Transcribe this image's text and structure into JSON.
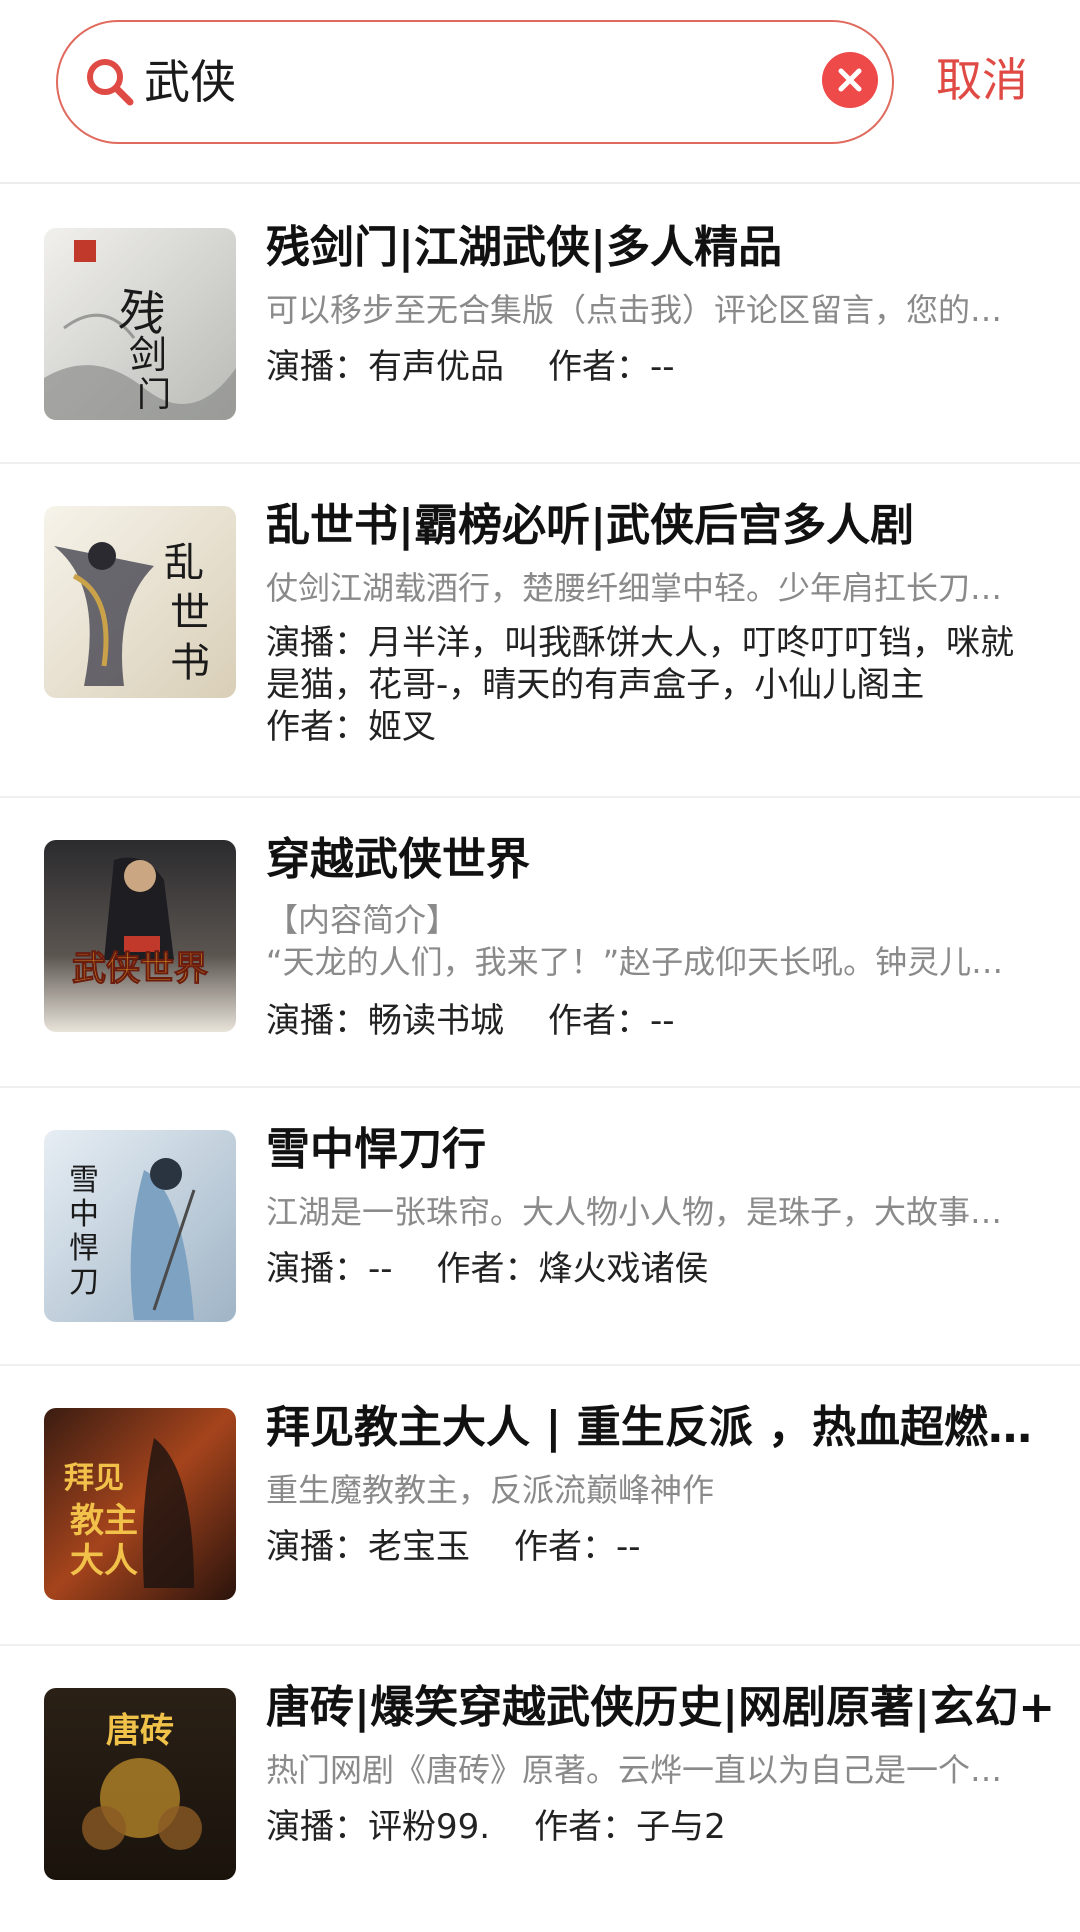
{
  "search": {
    "query": "武侠",
    "cancel_label": "取消"
  },
  "results": [
    {
      "title": "残剑门|江湖武侠|多人精品",
      "desc_lines": [
        "可以移步至无合集版（点击我）评论区留言，您的小小支持，我们的大大动力！"
      ],
      "narrator_label": "演播：",
      "narrator": "有声优品",
      "author_label": "作者：",
      "author": "--",
      "cover_text": "残剑门"
    },
    {
      "title": "乱世书|霸榜必听|武侠后宫多人剧",
      "desc_lines": [
        "仗剑江湖载酒行，楚腰纤细掌中轻。少年肩扛长刀，路过人间。"
      ],
      "narrator_label": "演播：",
      "narrator": "月半洋，叫我酥饼大人，叮咚叮叮铛，咪就是猫，花哥-，晴天的有声盒子，小仙儿阁主",
      "author_label": "作者：",
      "author": "姬叉",
      "cover_text": "乱世书"
    },
    {
      "title": "穿越武侠世界",
      "desc_lines": [
        "【内容简介】",
        "“天龙的人们，我来了！”赵子成仰天长吼。钟灵儿、王语嫣……"
      ],
      "narrator_label": "演播：",
      "narrator": "畅读书城",
      "author_label": "作者：",
      "author": "--",
      "cover_text": "武侠世界"
    },
    {
      "title": "雪中悍刀行",
      "desc_lines": [
        "江湖是一张珠帘。大人物小人物，是珠子，大故事小故事，是串线。"
      ],
      "narrator_label": "演播：",
      "narrator": "--",
      "author_label": "作者：",
      "author": "烽火戏诸侯",
      "cover_text": "雪中悍刀行"
    },
    {
      "title": "拜见教主大人 | 重生反派 ，热血超燃爽文",
      "desc_lines": [
        "重生魔教教主，反派流巅峰神作"
      ],
      "narrator_label": "演播：",
      "narrator": "老宝玉",
      "author_label": "作者：",
      "author": "--",
      "cover_text": "拜见教主大人"
    },
    {
      "title": "唐砖|爆笑穿越武侠历史|网剧原著|玄幻+",
      "desc_lines": [
        "热门网剧《唐砖》原著。云烨一直以为自己是一个好人，可以挽救大唐。"
      ],
      "narrator_label": "演播：",
      "narrator": "评粉99.",
      "author_label": "作者：",
      "author": "子与2",
      "cover_text": "唐砖"
    }
  ],
  "colors": {
    "accent": "#e04a44",
    "clear_button": "#ef4a4a",
    "description": "#8a8a8a"
  },
  "icons": [
    "search-icon",
    "clear-icon"
  ]
}
